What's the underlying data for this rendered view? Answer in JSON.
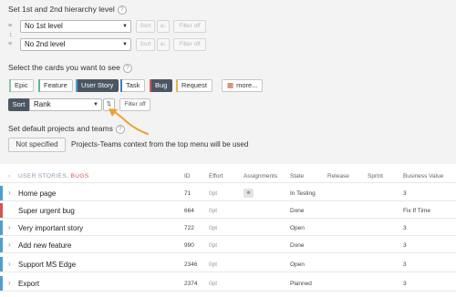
{
  "hierarchy": {
    "title": "Set 1st and 2nd hierarchy level",
    "help": "?",
    "level1": "No 1st level",
    "level2": "No 2nd level",
    "sort_label": "Sort",
    "sort_dir": "a↓",
    "filter_off": "Filter off"
  },
  "cards": {
    "title": "Select the cards you want to see",
    "help": "?",
    "types": [
      {
        "label": "Epic",
        "selected": false,
        "color": "#8cc6a0"
      },
      {
        "label": "Feature",
        "selected": false,
        "color": "#5bb5a2"
      },
      {
        "label": "User Story",
        "selected": true,
        "color": "#4b9fd5"
      },
      {
        "label": "Task",
        "selected": false,
        "color": "#3f7fc1"
      },
      {
        "label": "Bug",
        "selected": true,
        "color": "#d9534f"
      },
      {
        "label": "Request",
        "selected": false,
        "color": "#e5b64c"
      }
    ],
    "more": "more...",
    "more_icon": "grid-icon"
  },
  "sort": {
    "label": "Sort",
    "value": "Rank",
    "filter_off": "Filter off"
  },
  "defaults": {
    "title": "Set default projects and teams",
    "help": "?",
    "button": "Not specified",
    "context": "Projects-Teams context from the top menu will be used"
  },
  "grid": {
    "lead_prefix": "USER STORIES,",
    "lead_suffix": "BUGS",
    "columns": [
      "ID",
      "Effort",
      "Assignments",
      "State",
      "Release",
      "Sprint",
      "Business Value"
    ],
    "rows": [
      {
        "name": "Home page",
        "id": "71",
        "effort": "0pt",
        "state": "In Testing",
        "bv": "3",
        "stripe": "#4b9fd5",
        "expandable": true,
        "has_avatar": true
      },
      {
        "name": "Super urgent bug",
        "id": "664",
        "effort": "0pt",
        "state": "Done",
        "bv": "Fix If Time",
        "stripe": "#d9534f",
        "expandable": false,
        "has_avatar": false
      },
      {
        "name": "Very important story",
        "id": "722",
        "effort": "0pt",
        "state": "Open",
        "bv": "3",
        "stripe": "#4b9fd5",
        "expandable": true,
        "has_avatar": false
      },
      {
        "name": "Add new feature",
        "id": "990",
        "effort": "0pt",
        "state": "Done",
        "bv": "3",
        "stripe": "#4b9fd5",
        "expandable": true,
        "has_avatar": false
      },
      {
        "name": "Support MS Edge",
        "id": "2346",
        "effort": "0pt",
        "state": "Open",
        "bv": "3",
        "stripe": "#4b9fd5",
        "expandable": true,
        "has_avatar": false
      },
      {
        "name": "Export",
        "id": "2374",
        "effort": "0pt",
        "state": "Planned",
        "bv": "3",
        "stripe": "#4b9fd5",
        "expandable": true,
        "has_avatar": false
      }
    ]
  },
  "colors": {
    "accent": "#f0a030",
    "dark_button": "#4b5663",
    "settings_bg": "#f3f3f3"
  }
}
